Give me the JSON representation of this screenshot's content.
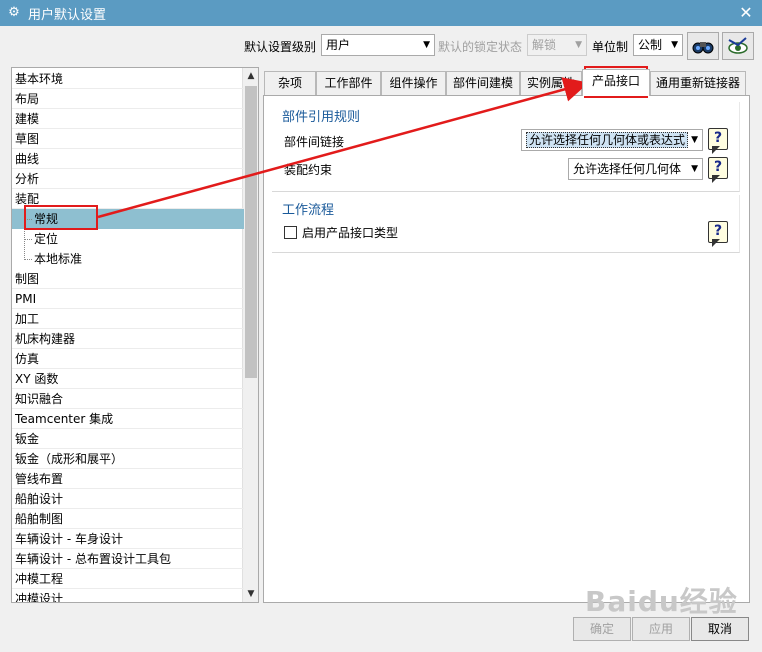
{
  "window": {
    "title": "用户默认设置",
    "close_glyph": "✕"
  },
  "toolbar": {
    "level_label": "默认设置级别",
    "level_value": "用户",
    "lock_label": "默认的锁定状态",
    "lock_value": "解锁",
    "unit_label": "单位制",
    "unit_value": "公制",
    "icons": [
      "binoculars-icon",
      "eye-arrow-icon"
    ]
  },
  "tree": {
    "items": [
      {
        "label": "基本环境",
        "level": 0
      },
      {
        "label": "布局",
        "level": 0
      },
      {
        "label": "建模",
        "level": 0
      },
      {
        "label": "草图",
        "level": 0
      },
      {
        "label": "曲线",
        "level": 0
      },
      {
        "label": "分析",
        "level": 0
      },
      {
        "label": "装配",
        "level": 0
      },
      {
        "label": "常规",
        "level": 1,
        "selected": true
      },
      {
        "label": "定位",
        "level": 1
      },
      {
        "label": "本地标准",
        "level": 1
      },
      {
        "label": "制图",
        "level": 0
      },
      {
        "label": "PMI",
        "level": 0
      },
      {
        "label": "加工",
        "level": 0
      },
      {
        "label": "机床构建器",
        "level": 0
      },
      {
        "label": "仿真",
        "level": 0
      },
      {
        "label": "XY 函数",
        "level": 0
      },
      {
        "label": "知识融合",
        "level": 0
      },
      {
        "label": "Teamcenter 集成",
        "level": 0
      },
      {
        "label": "钣金",
        "level": 0
      },
      {
        "label": "钣金（成形和展平）",
        "level": 0
      },
      {
        "label": "管线布置",
        "level": 0
      },
      {
        "label": "船舶设计",
        "level": 0
      },
      {
        "label": "船舶制图",
        "level": 0
      },
      {
        "label": "车辆设计 - 车身设计",
        "level": 0
      },
      {
        "label": "车辆设计 - 总布置设计工具包",
        "level": 0
      },
      {
        "label": "冲模工程",
        "level": 0
      },
      {
        "label": "冲模设计",
        "level": 0
      }
    ]
  },
  "tabs": [
    {
      "label": "杂项"
    },
    {
      "label": "工作部件"
    },
    {
      "label": "组件操作"
    },
    {
      "label": "部件间建模"
    },
    {
      "label": "实例属性"
    },
    {
      "label": "产品接口",
      "active": true
    },
    {
      "label": "通用重新链接器"
    }
  ],
  "panel": {
    "group1": {
      "title": "部件引用规则",
      "row1_label": "部件间链接",
      "row1_value": "允许选择任何几何体或表达式",
      "row2_label": "装配约束",
      "row2_value": "允许选择任何几何体"
    },
    "group2": {
      "title": "工作流程",
      "checkbox_label": "启用产品接口类型",
      "checked": false
    },
    "help_glyph": "?"
  },
  "buttons": {
    "ok": "确定",
    "apply": "应用",
    "cancel": "取消"
  },
  "watermark": "Baidu经验",
  "colors": {
    "titlebar": "#5b9bc2",
    "selection": "#8ebfd0",
    "group_title": "#1a5a9a",
    "annotation": "#e21b1b"
  }
}
